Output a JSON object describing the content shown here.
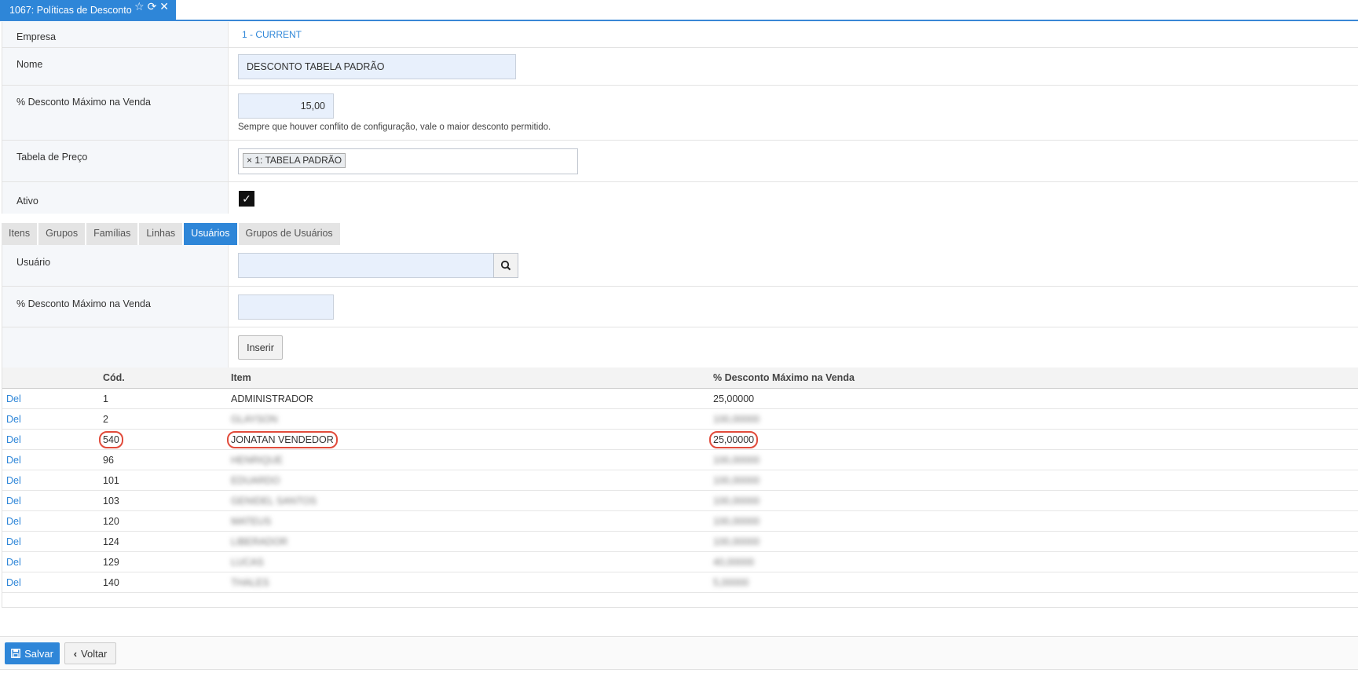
{
  "window": {
    "tab_title": "1067: Políticas de Desconto",
    "icons": [
      "star-icon",
      "refresh-icon",
      "close-icon"
    ]
  },
  "form": {
    "empresa": {
      "label": "Empresa",
      "value": "1 - CURRENT"
    },
    "nome": {
      "label": "Nome",
      "value": "DESCONTO TABELA PADRÃO"
    },
    "desconto": {
      "label": "% Desconto Máximo na Venda",
      "value": "15,00",
      "hint": "Sempre que houver conflito de configuração, vale o maior desconto permitido."
    },
    "tabela": {
      "label": "Tabela de Preço",
      "chip_remove": "×",
      "chip_label": "1: TABELA PADRÃO"
    },
    "ativo": {
      "label": "Ativo",
      "checked": true
    }
  },
  "tabs": [
    {
      "label": "Itens",
      "active": false
    },
    {
      "label": "Grupos",
      "active": false
    },
    {
      "label": "Famílias",
      "active": false
    },
    {
      "label": "Linhas",
      "active": false
    },
    {
      "label": "Usuários",
      "active": true
    },
    {
      "label": "Grupos de Usuários",
      "active": false
    }
  ],
  "subform": {
    "usuario": {
      "label": "Usuário",
      "value": ""
    },
    "desconto": {
      "label": "% Desconto Máximo na Venda",
      "value": ""
    },
    "insert_label": "Inserir"
  },
  "table": {
    "headers": [
      "",
      "Cód.",
      "Item",
      "% Desconto Máximo na Venda"
    ],
    "delete_label": "Del",
    "rows": [
      {
        "cod": "1",
        "item": "ADMINISTRADOR",
        "desconto": "25,00000",
        "blurred": false,
        "highlight": false
      },
      {
        "cod": "2",
        "item": "GLAYSON",
        "desconto": "100,00000",
        "blurred": true,
        "highlight": false
      },
      {
        "cod": "540",
        "item": "JONATAN VENDEDOR",
        "desconto": "25,00000",
        "blurred": false,
        "highlight": true
      },
      {
        "cod": "96",
        "item": "HENRIQUE",
        "desconto": "100,00000",
        "blurred": true,
        "highlight": false
      },
      {
        "cod": "101",
        "item": "EDUARDO",
        "desconto": "100,00000",
        "blurred": true,
        "highlight": false
      },
      {
        "cod": "103",
        "item": "GENIDEL SANTOS",
        "desconto": "100,00000",
        "blurred": true,
        "highlight": false
      },
      {
        "cod": "120",
        "item": "MATEUS",
        "desconto": "100,00000",
        "blurred": true,
        "highlight": false
      },
      {
        "cod": "124",
        "item": "LIBERADOR",
        "desconto": "100,00000",
        "blurred": true,
        "highlight": false
      },
      {
        "cod": "129",
        "item": "LUCAS",
        "desconto": "40,00000",
        "blurred": true,
        "highlight": false
      },
      {
        "cod": "140",
        "item": "THALES",
        "desconto": "5,00000",
        "blurred": true,
        "highlight": false
      }
    ]
  },
  "footer": {
    "save_label": "Salvar",
    "back_label": "Voltar"
  },
  "colors": {
    "accent": "#2e86d8",
    "highlight": "#e14b3b",
    "input_bg": "#e8f0fc"
  }
}
